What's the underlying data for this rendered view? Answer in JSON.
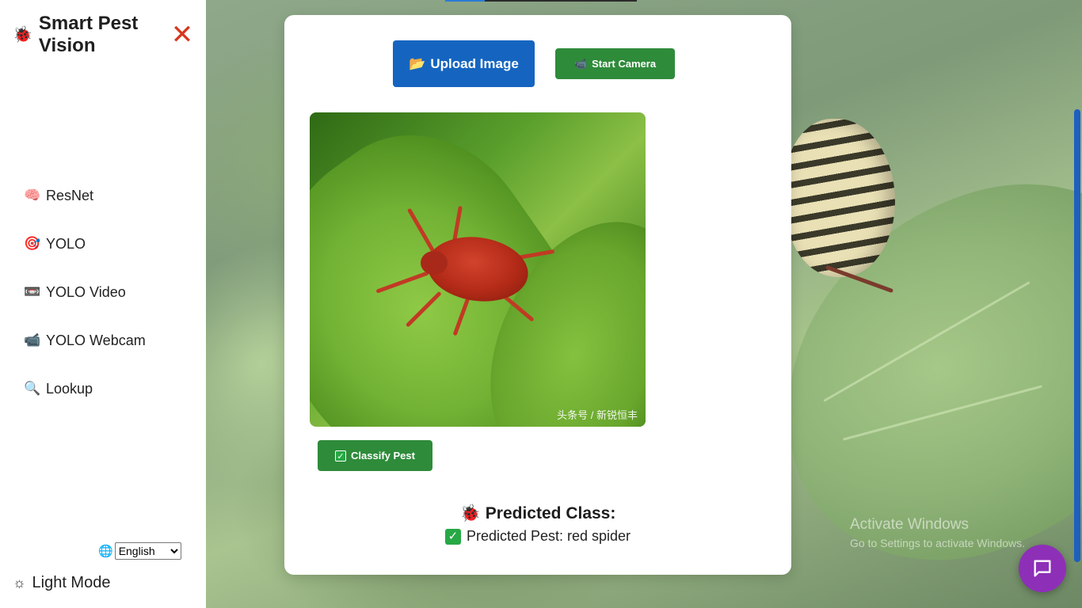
{
  "app": {
    "title": "Smart Pest Vision",
    "brand_icon": "bug-icon",
    "close_icon": "close-icon"
  },
  "sidebar": {
    "items": [
      {
        "icon": "brain-icon",
        "glyph": "🧠",
        "label": "ResNet"
      },
      {
        "icon": "target-icon",
        "glyph": "🎯",
        "label": "YOLO"
      },
      {
        "icon": "video-icon",
        "glyph": "📼",
        "label": "YOLO Video"
      },
      {
        "icon": "webcam-icon",
        "glyph": "📹",
        "label": "YOLO Webcam"
      },
      {
        "icon": "magnifier-icon",
        "glyph": "🔍",
        "label": "Lookup"
      }
    ],
    "language": {
      "selected": "English",
      "options": [
        "English"
      ]
    },
    "theme_toggle": {
      "icon": "sun-icon",
      "label": "Light Mode"
    }
  },
  "main": {
    "upload_button": {
      "icon": "folder-icon",
      "label": "Upload Image"
    },
    "camera_button": {
      "icon": "camera-icon",
      "label": "Start Camera"
    },
    "image": {
      "watermark": "头条号 / 新锐恒丰"
    },
    "classify_button": {
      "icon": "check-icon",
      "label": "Classify Pest"
    },
    "result": {
      "title_icon": "bug-icon",
      "title": "Predicted Class:",
      "line": "Predicted Pest: red spider"
    }
  },
  "os_watermark": {
    "line1": "Activate Windows",
    "line2": "Go to Settings to activate Windows."
  },
  "colors": {
    "upload_button": "#1565c0",
    "green_button": "#2e8b3a",
    "chat_fab": "#8e2fb8",
    "close_icon": "#d8381f"
  }
}
